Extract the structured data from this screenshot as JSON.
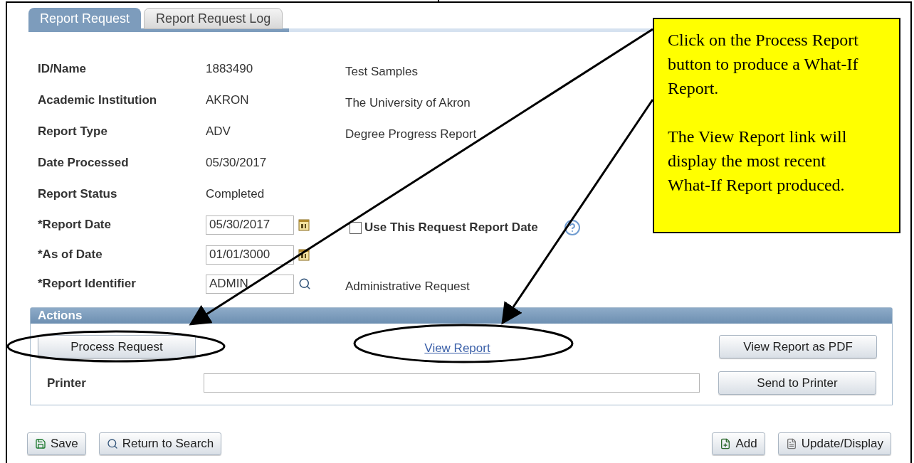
{
  "tabs": [
    {
      "label": "Report Request",
      "selected": true
    },
    {
      "label": "Report Request Log",
      "selected": false
    }
  ],
  "fields": [
    {
      "kind": "display",
      "label": "ID/Name",
      "value": "1883490",
      "description": "Test Samples"
    },
    {
      "kind": "display",
      "label": "Academic Institution",
      "value": "AKRON",
      "description": "The University of Akron"
    },
    {
      "kind": "display",
      "label": "Report Type",
      "value": "ADV",
      "description": "Degree Progress Report"
    },
    {
      "kind": "display",
      "label": "Date Processed",
      "value": "05/30/2017"
    },
    {
      "kind": "display",
      "label": "Report Status",
      "value": "Completed"
    },
    {
      "kind": "date",
      "label": "*Report Date",
      "value": "05/30/2017",
      "checkbox": {
        "label": "Use This Request Report Date",
        "checked": false
      }
    },
    {
      "kind": "date",
      "label": "*As of Date",
      "value": "01/01/3000"
    },
    {
      "kind": "lookup",
      "label": "*Report Identifier",
      "value": "ADMIN",
      "description": "Administrative Request"
    }
  ],
  "actions": {
    "title": "Actions",
    "process_button": "Process Request",
    "view_link": "View Report",
    "pdf_button": "View Report as PDF",
    "printer_label": "Printer",
    "send_button": "Send to Printer"
  },
  "toolbar": {
    "left": [
      {
        "kind": "save",
        "label": "Save"
      },
      {
        "kind": "return",
        "label": "Return to Search"
      }
    ],
    "right": [
      {
        "kind": "add",
        "label": "Add"
      },
      {
        "kind": "update",
        "label": "Update/Display"
      }
    ]
  },
  "callout": {
    "paragraphs": [
      "Click on the Process Report button to produce a What-If Report.",
      "The View Report link will display the most recent What-If Report produced."
    ]
  }
}
